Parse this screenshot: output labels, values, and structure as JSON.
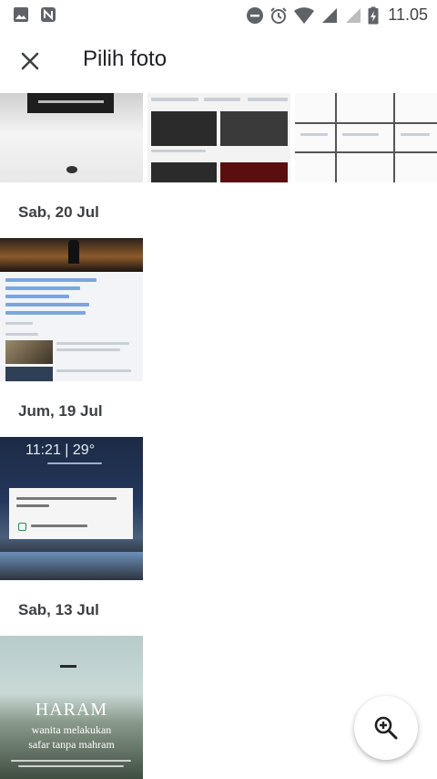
{
  "status_bar": {
    "time": "11.05",
    "icons": [
      "image-icon",
      "n-icon",
      "do-not-disturb-icon",
      "alarm-icon",
      "wifi-icon",
      "signal-icon",
      "signal-icon",
      "battery-icon"
    ]
  },
  "app_bar": {
    "title": "Pilih foto",
    "close_icon": "close-icon"
  },
  "sections": [
    {
      "date": "Sab, 20 Jul"
    },
    {
      "date": "Jum, 19 Jul"
    },
    {
      "date": "Sab, 13 Jul"
    }
  ],
  "thumbs": {
    "lockscreen_time": "11:21 | 29°",
    "haram_line1": "HARAM",
    "haram_line2": "wanita melakukan",
    "haram_line3": "safar tanpa mahram"
  },
  "fab": {
    "icon": "zoom-in-icon"
  },
  "colors": {
    "accent": "#3c4043",
    "background": "#ffffff"
  }
}
